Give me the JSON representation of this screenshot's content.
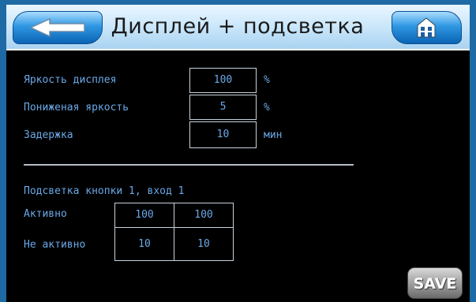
{
  "header": {
    "title": "Дисплей + подсветка",
    "back_icon": "arrow-left-icon",
    "home_icon": "home-icon"
  },
  "display_settings": {
    "brightness": {
      "label": "Яркость дисплея",
      "value": "100",
      "unit": "%"
    },
    "dim_brightness": {
      "label": "Пониженая яркость",
      "value": "5",
      "unit": "%"
    },
    "delay": {
      "label": "Задержка",
      "value": "10",
      "unit": "мин"
    }
  },
  "backlight": {
    "title": "Подсветка кнопки 1, вход 1",
    "rows": [
      {
        "label": "Активно",
        "values": [
          "100",
          "100"
        ]
      },
      {
        "label": "Не активно",
        "values": [
          "10",
          "10"
        ]
      }
    ]
  },
  "save_label": "SAVE",
  "colors": {
    "accent": "#1e6aa5",
    "text": "#6aa8e6",
    "background": "#000000"
  }
}
